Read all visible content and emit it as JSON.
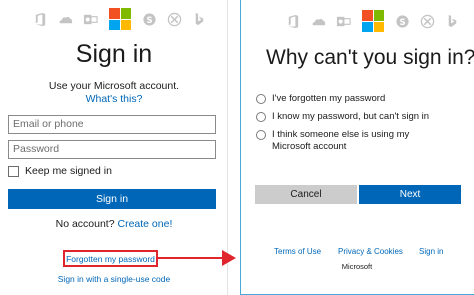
{
  "colors": {
    "accent": "#0067b8",
    "highlight": "#e0262c",
    "panel_border": "#4aa8d8",
    "ms_red": "#f25022",
    "ms_green": "#7fba00",
    "ms_blue": "#00a4ef",
    "ms_yellow": "#ffb900",
    "icon_gray": "#bdbdbd"
  },
  "product_icons": [
    "office-icon",
    "onedrive-icon",
    "outlook-icon",
    "microsoft-logo",
    "skype-icon",
    "xbox-icon",
    "bing-icon"
  ],
  "left": {
    "title": "Sign in",
    "subtitle": "Use your Microsoft account.",
    "whats_this": "What's this?",
    "email_placeholder": "Email or phone",
    "password_placeholder": "Password",
    "keep_signed_in": "Keep me signed in",
    "sign_in_button": "Sign in",
    "no_account_text": "No account?",
    "create_one": "Create one!",
    "forgot_password": "Forgotten my password",
    "single_use_code": "Sign in with a single-use code"
  },
  "right": {
    "title": "Why can't you sign in?",
    "options": [
      "I've forgotten my password",
      "I know my password, but can't sign in",
      "I think someone else is using my Microsoft account"
    ],
    "cancel_button": "Cancel",
    "next_button": "Next",
    "footer": {
      "terms": "Terms of Use",
      "privacy": "Privacy & Cookies",
      "sign_in": "Sign in",
      "brand": "Microsoft"
    }
  }
}
